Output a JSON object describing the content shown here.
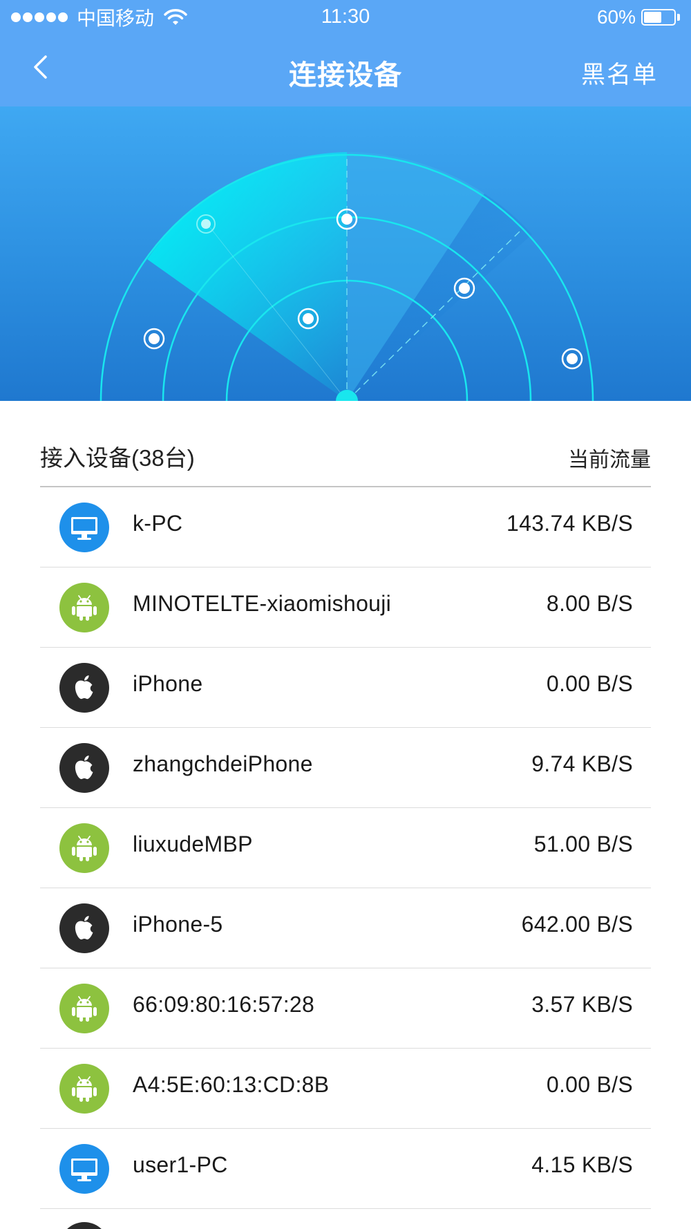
{
  "status_bar": {
    "carrier": "中国移动",
    "time": "11:30",
    "battery_percent": "60%",
    "battery_level": 0.6,
    "signal_icon": "signal-dots-icon",
    "wifi_icon": "wifi-icon"
  },
  "nav": {
    "title": "连接设备",
    "back_icon": "chevron-left-icon",
    "blacklist_label": "黑名单"
  },
  "list": {
    "count_label": "接入设备(38台)",
    "traffic_label": "当前流量",
    "devices": [
      {
        "name": "k-PC",
        "rate": "143.74 KB/S",
        "type": "pc"
      },
      {
        "name": "MINOTELTE-xiaomishouji",
        "rate": "8.00 B/S",
        "type": "android"
      },
      {
        "name": "iPhone",
        "rate": "0.00 B/S",
        "type": "apple"
      },
      {
        "name": "zhangchdeiPhone",
        "rate": "9.74 KB/S",
        "type": "apple"
      },
      {
        "name": "liuxudeMBP",
        "rate": "51.00 B/S",
        "type": "android"
      },
      {
        "name": "iPhone-5",
        "rate": "642.00 B/S",
        "type": "apple"
      },
      {
        "name": "66:09:80:16:57:28",
        "rate": "3.57 KB/S",
        "type": "android"
      },
      {
        "name": "A4:5E:60:13:CD:8B",
        "rate": "0.00 B/S",
        "type": "android"
      },
      {
        "name": "user1-PC",
        "rate": "4.15 KB/S",
        "type": "pc"
      }
    ]
  },
  "icons": {
    "pc": "monitor-icon",
    "android": "android-icon",
    "apple": "apple-icon"
  },
  "colors": {
    "header_bg": "#5aa7f6",
    "radar_accent": "#00f0f0",
    "pc_icon_bg": "#1e90ea",
    "android_icon_bg": "#8dc23f",
    "apple_icon_bg": "#2b2b2b"
  }
}
